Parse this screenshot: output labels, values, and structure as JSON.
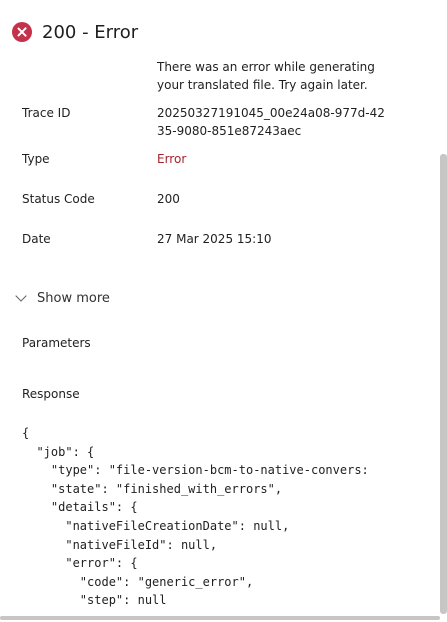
{
  "header": {
    "title": "200 - Error",
    "icon": "error-icon",
    "icon_color": "#c4314b"
  },
  "message": "There was an error while generating your translated file. Try again later.",
  "details": [
    {
      "label": "Trace ID",
      "value": "20250327191045_00e24a08-977d-4235-9080-851e87243aec"
    },
    {
      "label": "Type",
      "value": "Error"
    },
    {
      "label": "Status Code",
      "value": "200"
    },
    {
      "label": "Date",
      "value": "27 Mar 2025 15:10"
    }
  ],
  "show_more": {
    "label": "Show more",
    "icon": "chevron-down-icon"
  },
  "parameters": {
    "label": "Parameters"
  },
  "response": {
    "label": "Response",
    "json_text": "{\n  \"job\": {\n    \"type\": \"file-version-bcm-to-native-convers:\n    \"state\": \"finished_with_errors\",\n    \"details\": {\n      \"nativeFileCreationDate\": null,\n      \"nativeFileId\": null,\n      \"error\": {\n        \"code\": \"generic_error\",\n        \"step\": null\n      }"
  },
  "colors": {
    "error_text": "#a4262c",
    "scrollbar": "#c8c6c4"
  }
}
